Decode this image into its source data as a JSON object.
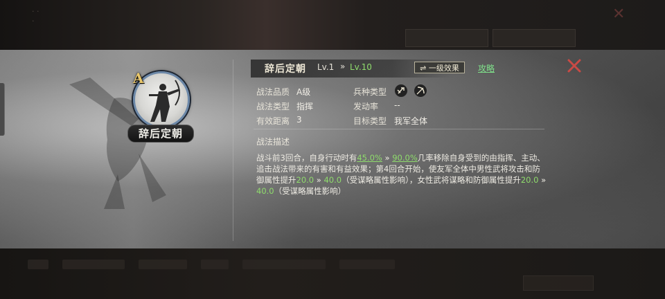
{
  "background": {
    "tabs": [
      "",
      ""
    ]
  },
  "skill": {
    "grade_badge": "A",
    "name_plate": "辞后定朝",
    "name": "辞后定朝",
    "level_current": "Lv.1",
    "level_arrow": "»",
    "level_max": "Lv.10",
    "effect_button": "⇌ 一级效果",
    "guide_link": "攻略"
  },
  "info": {
    "quality_label": "战法品质",
    "quality_value": "A级",
    "troop_label": "兵种类型",
    "type_label": "战法类型",
    "type_value": "指挥",
    "rate_label": "发动率",
    "rate_value": "--",
    "range_label": "有效距离",
    "range_value": "3",
    "target_label": "目标类型",
    "target_value": "我军全体"
  },
  "description": {
    "title": "战法描述",
    "seg1": "战斗前3回合，自身行动时有",
    "v1a": "45.0%",
    "arrow1": " » ",
    "v1b": "90.0%",
    "seg2": "几率移除自身受到的由指挥、主动、追击战法带来的有害和有益效果；第4回合开始，使友军全体中男性武将攻击和防御属性提升",
    "v2a": "20.0",
    "arrow2": " » ",
    "v2b": "40.0",
    "seg3": "（受谋略属性影响），女性武将谋略和防御属性提升",
    "v3a": "20.0",
    "arrow3": " » ",
    "v3b": "40.0",
    "seg4": "（受谋略属性影响）"
  },
  "icons": {
    "close": "close-x-icon",
    "troop1": "cavalry-icon",
    "troop2": "archer-icon"
  },
  "colors": {
    "highlight_green": "#8fdc6c",
    "close_red": "#c94a45",
    "portrait_ring": "#6c88a8",
    "grade_gold": "#e8c66a"
  }
}
